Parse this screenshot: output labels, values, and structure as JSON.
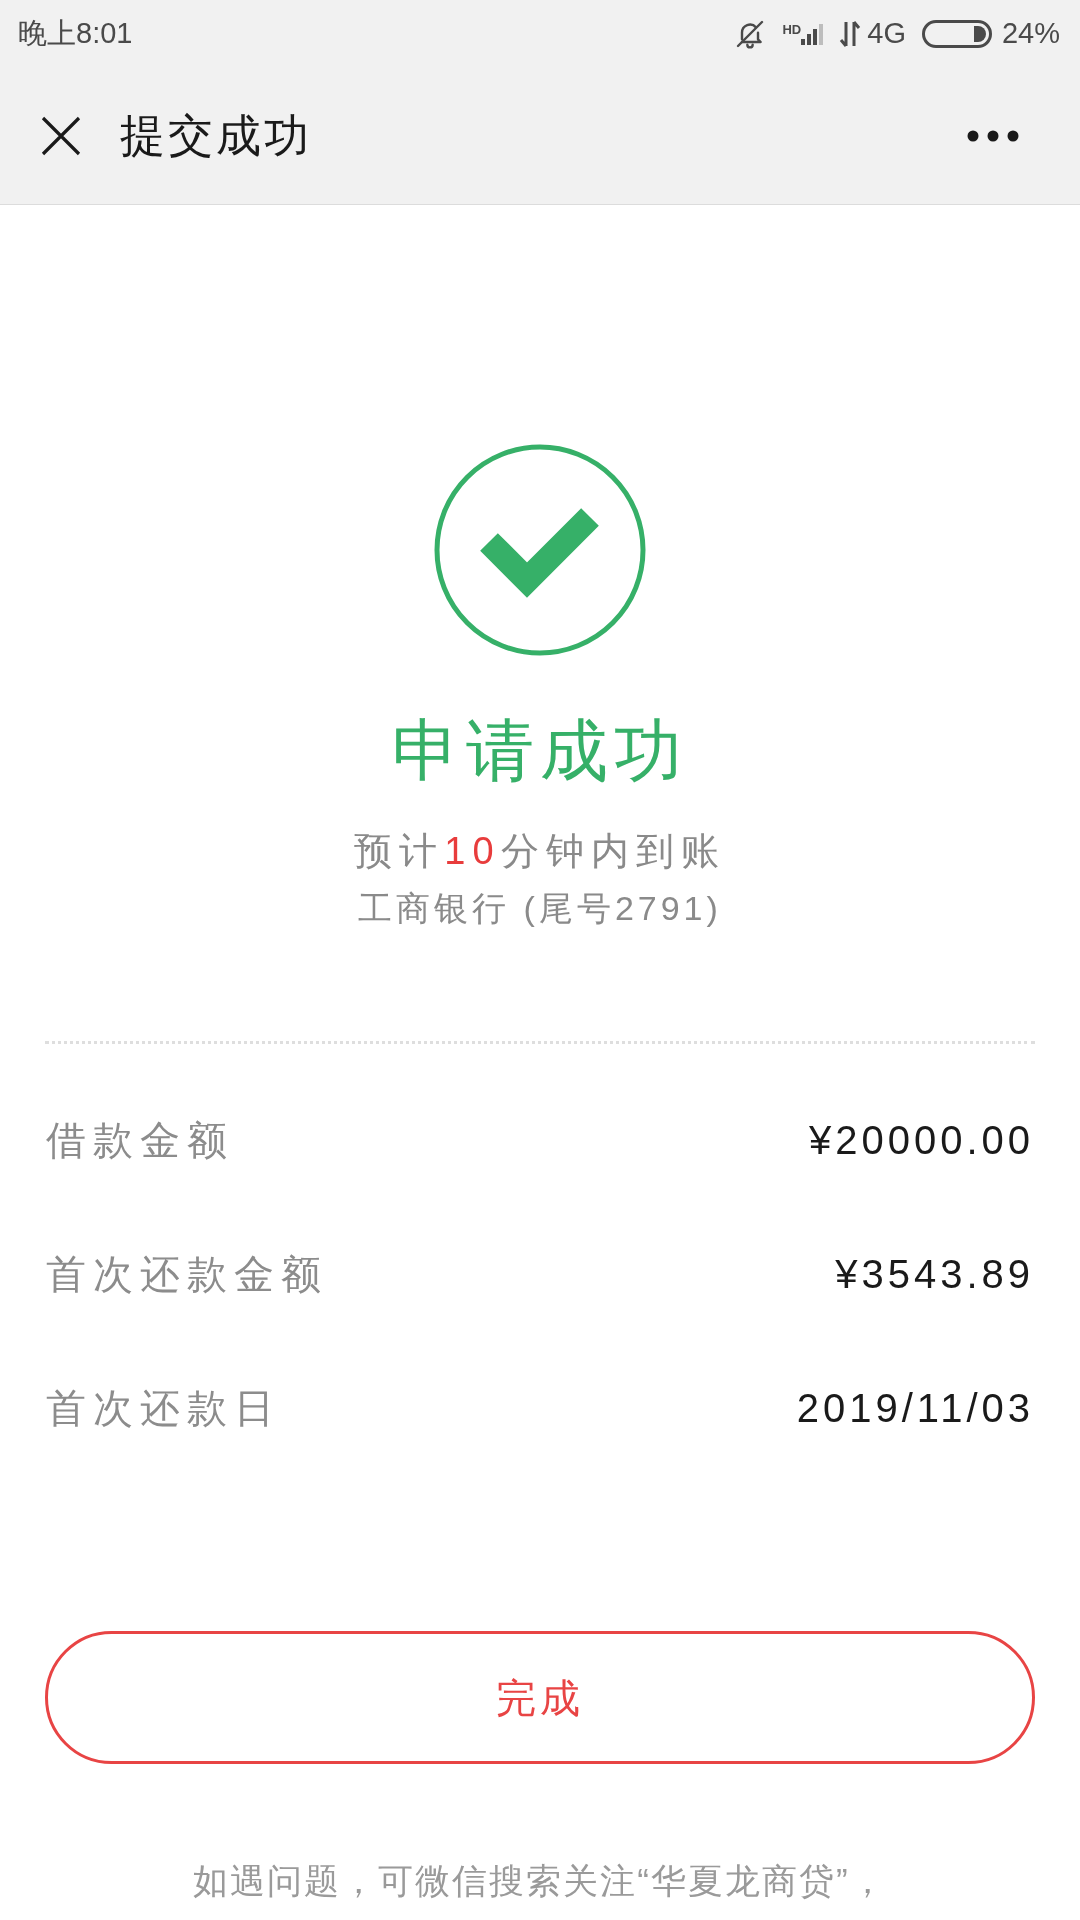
{
  "status_bar": {
    "time": "晚上8:01",
    "network_badge": "HD",
    "network": "4G",
    "battery": "24%"
  },
  "header": {
    "title": "提交成功"
  },
  "result": {
    "title": "申请成功",
    "eta": [
      {
        "text": "预计",
        "highlight": false
      },
      {
        "text": "10",
        "highlight": true
      },
      {
        "text": "分钟内到账",
        "highlight": false
      }
    ],
    "account": "工商银行 (尾号2791)"
  },
  "details": [
    {
      "label": "借款金额",
      "value": "¥20000.00"
    },
    {
      "label": "首次还款金额",
      "value": "¥3543.89"
    },
    {
      "label": "首次还款日",
      "value": "2019/11/03"
    }
  ],
  "done_button": {
    "label": "完成"
  },
  "footer_note": "如遇问题，可微信搜索关注“华夏龙商贷”，"
}
